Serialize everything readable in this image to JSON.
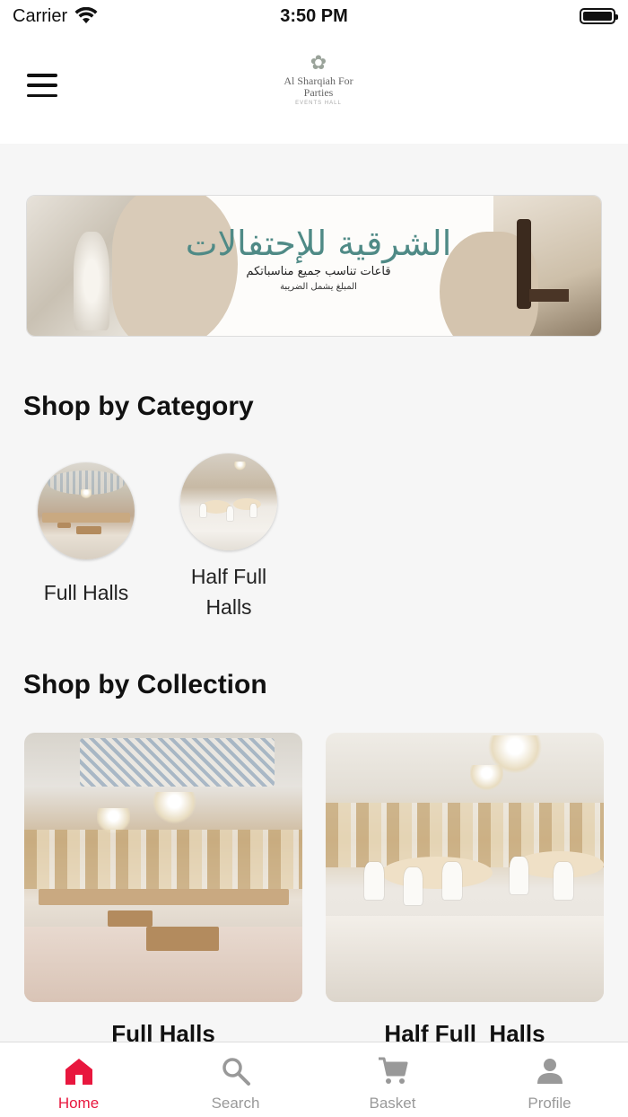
{
  "status_bar": {
    "carrier": "Carrier",
    "time": "3:50 PM"
  },
  "header": {
    "logo_line1": "Al Sharqiah For",
    "logo_line2": "Parties",
    "logo_line3": "EVENTS HALL"
  },
  "banner": {
    "title_ar": "الشرقية للإحتفالات",
    "subtitle_ar": "قاعات تناسب جميع مناسباتكم",
    "note_ar": "المبلغ يشمل الضريبة"
  },
  "sections": {
    "category_title": "Shop by Category",
    "collection_title": "Shop by Collection"
  },
  "categories": [
    {
      "label": "Full Halls"
    },
    {
      "label": "Half Full Halls"
    }
  ],
  "collections": [
    {
      "title": "Full Halls"
    },
    {
      "title": "Half Full  Halls"
    }
  ],
  "tabbar": {
    "tabs": [
      {
        "label": "Home",
        "icon": "home-icon",
        "active": true
      },
      {
        "label": "Search",
        "icon": "search-icon",
        "active": false
      },
      {
        "label": "Basket",
        "icon": "cart-icon",
        "active": false
      },
      {
        "label": "Profile",
        "icon": "person-icon",
        "active": false
      }
    ]
  },
  "colors": {
    "accent": "#e8173e",
    "inactive": "#999999",
    "banner_title": "#4f8a86"
  }
}
